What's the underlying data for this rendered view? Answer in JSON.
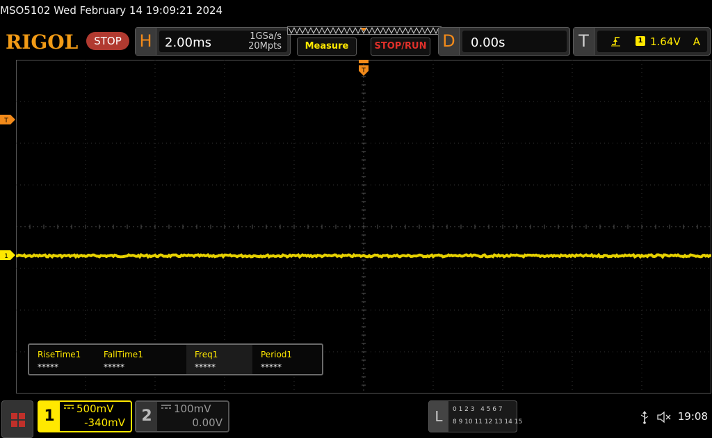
{
  "title": "MSO5102  Wed February 14 19:09:21 2024",
  "brand": {
    "logo": "RIGOL",
    "run_state": "STOP"
  },
  "horizontal": {
    "letter": "H",
    "timebase": "2.00ms",
    "sample_rate": "1GSa/s",
    "memory_depth": "20Mpts"
  },
  "buttons": {
    "measure": "Measure",
    "stop_run": "STOP/RUN"
  },
  "delay": {
    "letter": "D",
    "value": "0.00s"
  },
  "trigger": {
    "letter": "T",
    "slope_icon": "rising-edge-icon",
    "source": "1",
    "level": "1.64V",
    "mode": "A"
  },
  "markers": {
    "channel1": "1",
    "trigger_level": "T"
  },
  "measurements": [
    {
      "name": "RiseTime1",
      "value": "*****"
    },
    {
      "name": "FallTime1",
      "value": "*****"
    },
    {
      "name": "Freq1",
      "value": "*****"
    },
    {
      "name": "Period1",
      "value": "*****"
    }
  ],
  "channels": {
    "ch1": {
      "num": "1",
      "coupling_icon": "dc-coupling-icon",
      "scale": "500mV",
      "offset": "-340mV",
      "color": "#ffe800"
    },
    "ch2": {
      "num": "2",
      "coupling_icon": "dc-coupling-icon",
      "scale": "100mV",
      "offset": "0.00V",
      "color": "#999999"
    }
  },
  "logic": {
    "letter": "L",
    "row1": "0 1 2 3   4 5 6 7",
    "row2": "8 9 10 11 12 13 14 15"
  },
  "status": {
    "time": "19:08"
  },
  "colors": {
    "accent": "#f29b16",
    "ch1": "#ffe800",
    "stop": "#b13a30"
  }
}
